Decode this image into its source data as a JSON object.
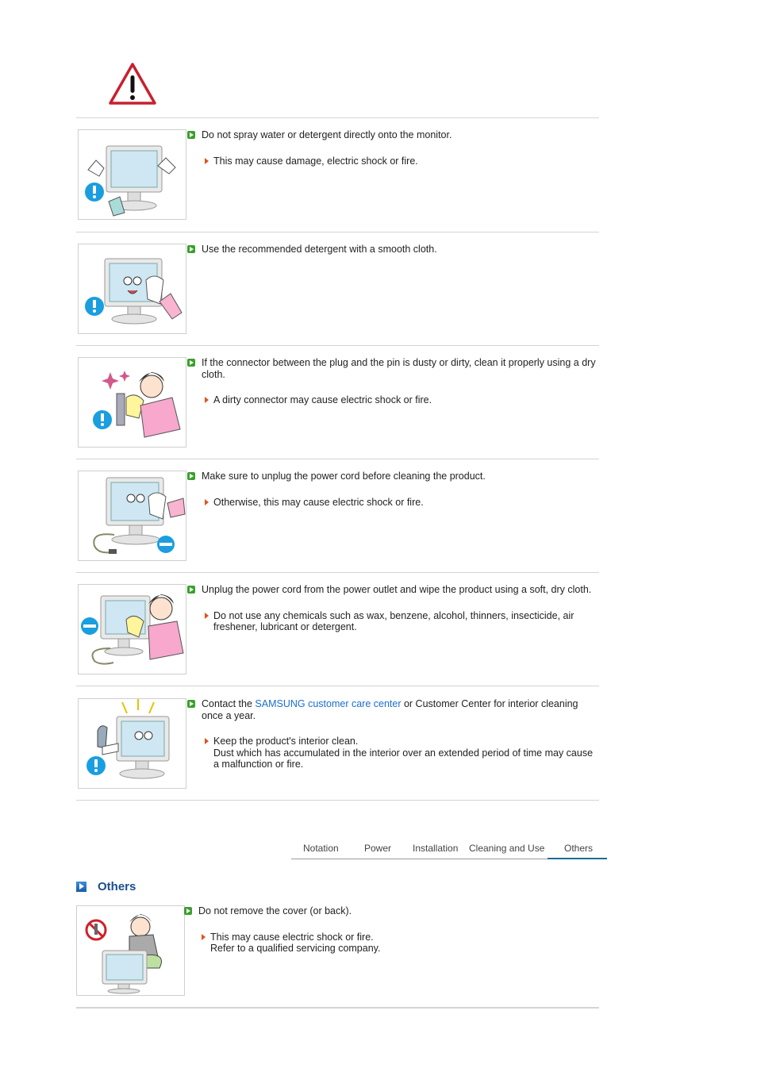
{
  "page": {
    "warning_icon": "warning-triangle-icon",
    "items": [
      {
        "image": "spray-monitor-illustration",
        "main": "Do not spray water or detergent directly onto the monitor.",
        "sub": [
          "This may cause damage, electric shock or fire."
        ]
      },
      {
        "image": "wipe-monitor-cloth-illustration",
        "main": "Use the recommended detergent with a smooth cloth.",
        "sub": []
      },
      {
        "image": "clean-connector-illustration",
        "main": "If the connector between the plug and the pin is dusty or dirty, clean it properly using a dry cloth.",
        "sub": [
          "A dirty connector may cause electric shock or fire."
        ]
      },
      {
        "image": "unplug-before-cleaning-illustration",
        "main": "Make sure to unplug the power cord before cleaning the product.",
        "sub": [
          "Otherwise, this may cause electric shock or fire."
        ]
      },
      {
        "image": "unplug-wipe-soft-cloth-illustration",
        "main": "Unplug the power cord from the power outlet and wipe the product using a soft, dry cloth.",
        "sub": [
          "Do not use any chemicals such as wax, benzene, alcohol, thinners, insecticide, air freshener, lubricant or detergent."
        ]
      },
      {
        "image": "interior-cleaning-illustration",
        "main_prefix": "Contact the ",
        "main_link": "SAMSUNG customer care center",
        "main_suffix": " or Customer Center for interior cleaning once a year.",
        "sub_lines": [
          "Keep the product's interior clean.",
          "Dust which has accumulated in the interior over an extended period of time may cause a malfunction or fire."
        ]
      }
    ]
  },
  "tabs": [
    {
      "label": "Notation",
      "active": false
    },
    {
      "label": "Power",
      "active": false
    },
    {
      "label": "Installation",
      "active": false
    },
    {
      "label": "Cleaning and Use",
      "active": false
    },
    {
      "label": "Others",
      "active": true
    }
  ],
  "others_section": {
    "title": "Others",
    "item": {
      "image": "do-not-remove-cover-illustration",
      "main": "Do not remove the cover (or back).",
      "sub_lines": [
        "This may cause electric shock or fire.",
        "Refer to a qualified servicing company."
      ]
    }
  },
  "colors": {
    "link": "#1a6fd0",
    "bullet_green": "#3aa02c",
    "arrow_orange": "#e0531f",
    "section_title": "#1a4f8c",
    "active_tab_underline": "#1a6c96",
    "warning_red": "#c8202f"
  }
}
